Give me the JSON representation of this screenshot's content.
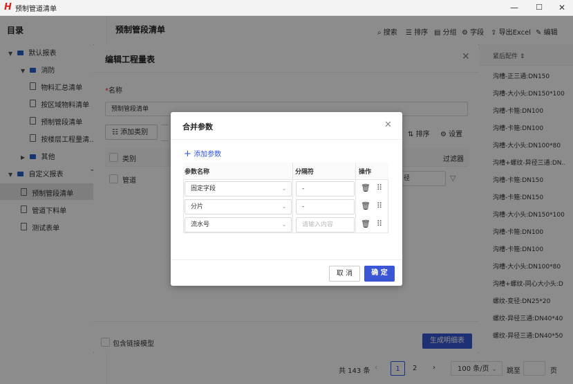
{
  "window": {
    "title": "预制管道清单",
    "logo": "H",
    "min": "—",
    "max": "☐",
    "close": "✕"
  },
  "sidebar": {
    "title": "目录",
    "items": [
      {
        "label": "默认报表"
      },
      {
        "label": "消防"
      },
      {
        "label": "物料汇总清单"
      },
      {
        "label": "按区域物料清单"
      },
      {
        "label": "预制管段清单"
      },
      {
        "label": "按楼层工程量清…"
      },
      {
        "label": "其他"
      },
      {
        "label": "自定义报表"
      },
      {
        "label": "预制管段清单"
      },
      {
        "label": "管道下料单"
      },
      {
        "label": "测试表单"
      }
    ],
    "add": "+"
  },
  "main": {
    "title": "预制管段清单",
    "toolbar": {
      "search": "搜索",
      "sort": "排序",
      "group": "分组",
      "field": "字段",
      "export": "导出Excel",
      "edit": "编辑"
    },
    "right_header": "紧后配件",
    "right_cells": [
      "沟槽-正三通:DN150",
      "沟槽-大小头:DN150*100",
      "沟槽-卡箍:DN100",
      "沟槽-卡箍:DN100",
      "沟槽-大小头:DN100*80",
      "沟槽+螺纹-异径三通:DN...",
      "沟槽-卡箍:DN150",
      "沟槽-卡箍:DN150",
      "沟槽-大小头:DN150*100",
      "沟槽-卡箍:DN100",
      "沟槽-卡箍:DN100",
      "沟槽-大小头:DN100*80",
      "沟槽+螺纹-同心大小头:D",
      "螺纹-变径:DN25*20",
      "螺纹-异径三通:DN40*40",
      "螺纹-异径三通:DN40*50"
    ],
    "pagination": {
      "total": "共 143 条",
      "page1": "1",
      "page2": "2",
      "per_page": "100 条/页",
      "jump": "跳至",
      "page_suffix": "页"
    }
  },
  "dialog1": {
    "title": "编辑工程量表",
    "name_label": "名称",
    "name_value": "预制管段清单",
    "add_category": "添加类别",
    "sort": "排序",
    "settings": "设置",
    "col_category": "类别",
    "col_filter": "过滤器",
    "row_category": "管道",
    "row_partial": "径",
    "include_link": "包含链接模型",
    "generate": "生成明细表"
  },
  "dialog2": {
    "title": "合并参数",
    "add_param": "添加参数",
    "headers": {
      "name": "参数名称",
      "sep": "分隔符",
      "op": "操作"
    },
    "rows": [
      {
        "name": "固定字段",
        "sep": "-",
        "sep_placeholder": ""
      },
      {
        "name": "分片",
        "sep": "-",
        "sep_placeholder": ""
      },
      {
        "name": "流水号",
        "sep": "",
        "sep_placeholder": "请输入内容"
      }
    ],
    "cancel": "取 消",
    "ok": "确 定"
  }
}
